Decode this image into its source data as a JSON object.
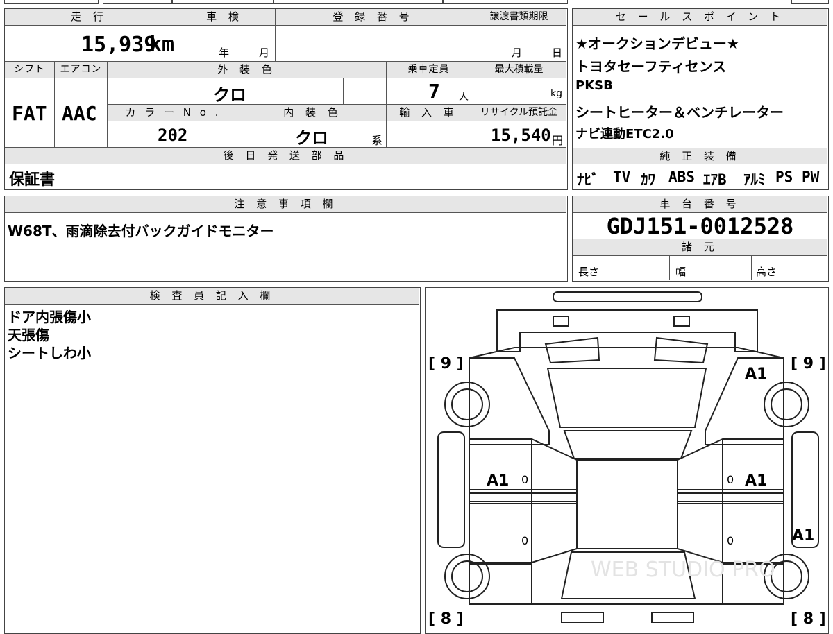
{
  "sheet": {
    "headers": {
      "mileage": "走 行",
      "inspection": "車 検",
      "registration": "登 録 番 号",
      "transfer_deadline": "譲渡書類期限",
      "shift": "シフト",
      "aircon": "エアコン",
      "exterior_color": "外 装 色",
      "capacity": "乗車定員",
      "max_load": "最大積載量",
      "color_no": "カ ラ ー N o .",
      "interior_color": "内 装 色",
      "import": "輸 入 車",
      "recycle": "リサイクル預託金",
      "shipping_parts": "後 日 発 送 部 品",
      "notes": "注 意 事 項 欄",
      "sales_points": "セ ー ル ス ポ イ ン ト",
      "genuine_equipment": "純 正 装 備",
      "chassis_no": "車 台 番 号",
      "specs": "諸 元",
      "inspector": "検 査 員 記 入 欄"
    },
    "mileage_value": "15,939",
    "mileage_unit": "km",
    "inspection_year_unit": "年",
    "inspection_month_unit": "月",
    "transfer_month_unit": "月",
    "transfer_day_unit": "日",
    "shift_value": "FAT",
    "aircon_value": "AAC",
    "exterior_color_value": "クロ",
    "capacity_value": "7",
    "capacity_unit": "人",
    "max_load_unit": "kg",
    "color_no_value": "202",
    "interior_color_value": "クロ",
    "interior_color_suffix": "系",
    "recycle_value": "15,540",
    "recycle_unit": "円",
    "shipping_parts_value": "保証書",
    "notes_value": "W68T、雨滴除去付バックガイドモニター",
    "sales_points": [
      "★オークションデビュー★",
      "トヨタセーフティセンス",
      "PKSB",
      "シートヒーター＆ベンチレーター",
      "ナビ連動ETC2.0"
    ],
    "genuine_equipment": [
      "ﾅﾋﾞ",
      "TV",
      "ｶﾜ",
      "ABS",
      "ｴｱB",
      "ｱﾙﾐ",
      "PS",
      "PW"
    ],
    "chassis_no_value": "GDJ151-0012528",
    "specs_labels": {
      "length": "長さ",
      "width": "幅",
      "height": "高さ"
    },
    "inspector_notes": [
      "ドア内張傷小",
      "天張傷",
      "シートしわ小"
    ]
  },
  "diagram": {
    "tread_front": "[ 9 ]",
    "tread_rear": "[ 8 ]",
    "marks": {
      "roof_front_right": "A1",
      "front_left_door": "A1",
      "front_right_door": "A1",
      "rear_right_quarter": "A1",
      "fld_zero": "0",
      "frd_zero": "0",
      "rld_zero": "0",
      "rrd_zero": "0"
    },
    "watermark": "WEB STUDIO PRO"
  }
}
